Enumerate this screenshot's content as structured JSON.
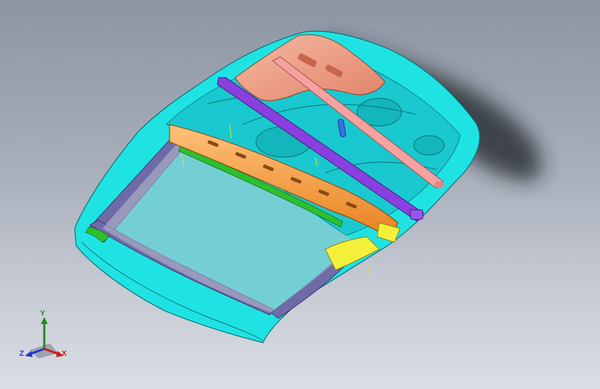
{
  "viewport": {
    "background_top": "#8d95a3",
    "background_bottom": "#d9dde4"
  },
  "model": {
    "part_colors": {
      "outer_panel": "#1fe3e3",
      "inner_panel": "#19c9cf",
      "hinge_reinforcement": "#f0a48a",
      "tube_bar": "#f7a2a0",
      "cross_bar": "#8a3fe0",
      "lower_beam": "#f39a3a",
      "seal": "#2dbf2d",
      "frame_rail": "#6f6aa8",
      "bracket": "#f4f03a",
      "latch": "#3a6fe0"
    }
  },
  "triad": {
    "y_label": "Y",
    "x_label": "X",
    "z_label": "Z",
    "colors": {
      "y": "#1d8a1d",
      "x": "#cc1b1b",
      "z": "#2233cc"
    }
  }
}
